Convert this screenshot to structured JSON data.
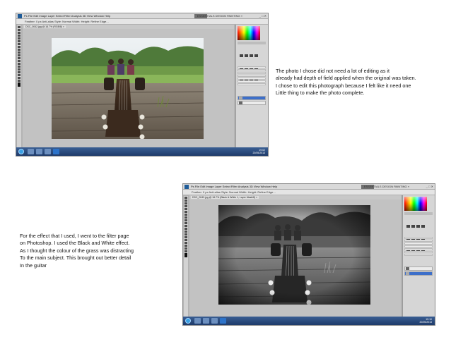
{
  "screenshot_top": {
    "menus": "Ps  File  Edit  Image  Layer  Select  Filter  Analysis  3D  View  Window  Help",
    "workspaces": "ESSENTIALS   DESIGN   PAINTING   »",
    "window_controls": "_ □ ✕",
    "options": "Feather: 0 px   Anti-alias   Style: Normal   Width:   Height:   Refine Edge...",
    "doc_tab": "DSC_0042.jpg @ 16.7% (RGB/8) ×",
    "clock_time": "19:02",
    "clock_date": "20/05/2013",
    "photo_style": "color"
  },
  "screenshot_bottom": {
    "menus": "Ps  File  Edit  Image  Layer  Select  Filter  Analysis  3D  View  Window  Help",
    "workspaces": "ESSENTIALS   DESIGN   PAINTING   »",
    "window_controls": "_ □ ✕",
    "options": "Feather: 0 px   Anti-alias   Style: Normal   Width:   Height:   Refine Edge...",
    "doc_tab": "DSC_0042.jpg @ 16.7% (Black & White 1, Layer Mask/8) ×",
    "clock_time": "19:10",
    "clock_date": "20/05/2013",
    "photo_style": "black-and-white"
  },
  "caption_top": {
    "lines": [
      "The photo I chose did not need a lot of editing as it",
      "already had depth of field applied when the original was taken.",
      "I chose to edit this photograph because I felt like it need one",
      "Little thing to make the photo complete."
    ]
  },
  "caption_bottom": {
    "lines": [
      "For the effect that I used, I went to the filter page",
      "on Photoshop. I used the Black and White effect.",
      "As I thought the colour of the grass was distracting",
      "To the main subject. This brought out better detail",
      "In the guitar"
    ]
  },
  "colors": {
    "workspace_gray": "#b3b3b3",
    "taskbar_blue": "#1e3a6a",
    "layer_selected": "#3d6fc9"
  }
}
